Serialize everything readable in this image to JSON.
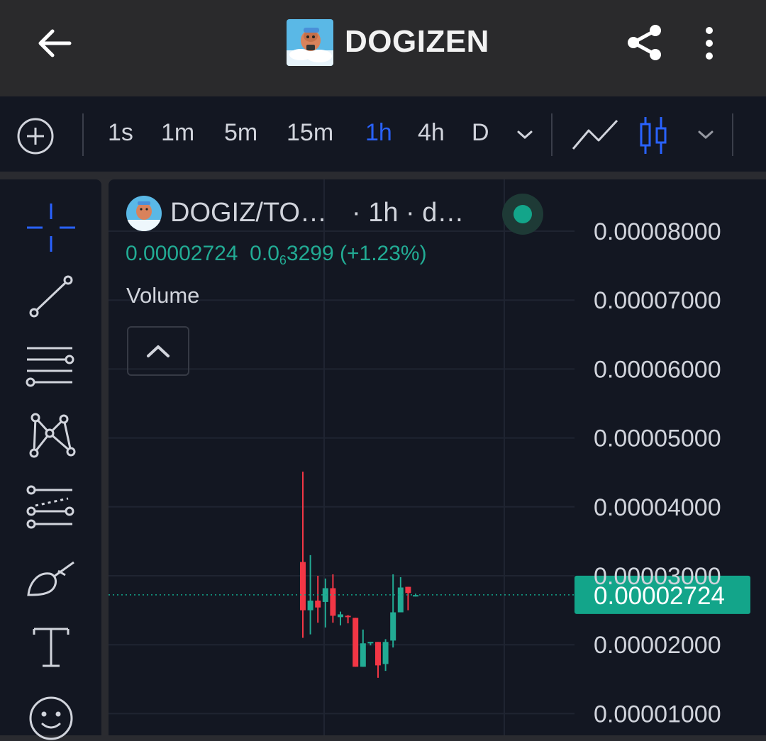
{
  "header": {
    "title": "DOGIZEN",
    "back_icon": "arrow-left-icon",
    "share_icon": "share-icon",
    "menu_icon": "more-vertical-icon"
  },
  "toolbar": {
    "add_icon": "plus-circle-icon",
    "intervals": [
      "1s",
      "1m",
      "5m",
      "15m",
      "1h",
      "4h",
      "D"
    ],
    "active_interval": "1h",
    "chart_types": [
      "line-chart-icon",
      "candlestick-icon"
    ],
    "active_chart_type": "candlestick"
  },
  "tools": [
    "crosshair-icon",
    "trend-line-icon",
    "horizontal-lines-icon",
    "pattern-icon",
    "fib-retracement-icon",
    "brush-icon",
    "text-icon",
    "emoji-icon"
  ],
  "legend": {
    "symbol": "DOGIZ/TO…",
    "interval_suffix": "· 1h · d…",
    "last_price": "0.00002724",
    "change_prefix": "0.0",
    "change_subscript": "6",
    "change_rest": "3299",
    "change_pct": "(+1.23%)",
    "volume_label": "Volume"
  },
  "colors": {
    "up": "#22ab94",
    "down": "#f23645",
    "accent": "#2962ff",
    "price_tag": "#13a58a",
    "background": "#131722"
  },
  "chart_data": {
    "type": "candlestick",
    "ylim": [
      1e-05,
      8.5e-05
    ],
    "y_ticks": [
      "0.00008000",
      "0.00007000",
      "0.00006000",
      "0.00005000",
      "0.00004000",
      "0.00003000",
      "0.00002000",
      "0.00001000"
    ],
    "last_price_label": "0.00002724",
    "last_price": 2.724e-05,
    "candles": [
      {
        "o": 3.2e-05,
        "h": 4.51e-05,
        "l": 2.1e-05,
        "c": 2.5e-05
      },
      {
        "o": 2.5e-05,
        "h": 3.3e-05,
        "l": 2.15e-05,
        "c": 2.64e-05
      },
      {
        "o": 2.64e-05,
        "h": 3e-05,
        "l": 2.32e-05,
        "c": 2.54e-05
      },
      {
        "o": 2.62e-05,
        "h": 2.96e-05,
        "l": 2.25e-05,
        "c": 2.82e-05
      },
      {
        "o": 2.82e-05,
        "h": 3.02e-05,
        "l": 2.32e-05,
        "c": 2.42e-05
      },
      {
        "o": 2.4e-05,
        "h": 2.48e-05,
        "l": 2.28e-05,
        "c": 2.44e-05
      },
      {
        "o": 2.42e-05,
        "h": 2.43e-05,
        "l": 2.31e-05,
        "c": 2.41e-05
      },
      {
        "o": 2.39e-05,
        "h": 2.39e-05,
        "l": 1.68e-05,
        "c": 1.68e-05
      },
      {
        "o": 1.68e-05,
        "h": 2.22e-05,
        "l": 1.68e-05,
        "c": 2.02e-05
      },
      {
        "o": 2.02e-05,
        "h": 2.04e-05,
        "l": 1.99e-05,
        "c": 2.04e-05
      },
      {
        "o": 2.04e-05,
        "h": 2.04e-05,
        "l": 1.52e-05,
        "c": 1.7e-05
      },
      {
        "o": 1.72e-05,
        "h": 2.08e-05,
        "l": 1.62e-05,
        "c": 2.04e-05
      },
      {
        "o": 2.06e-05,
        "h": 3.02e-05,
        "l": 1.96e-05,
        "c": 2.47e-05
      },
      {
        "o": 2.47e-05,
        "h": 2.98e-05,
        "l": 2.47e-05,
        "c": 2.83e-05
      },
      {
        "o": 2.84e-05,
        "h": 2.84e-05,
        "l": 2.5e-05,
        "c": 2.75e-05
      },
      {
        "o": 2.72e-05,
        "h": 2.74e-05,
        "l": 2.7e-05,
        "c": 2.72e-05
      }
    ]
  }
}
